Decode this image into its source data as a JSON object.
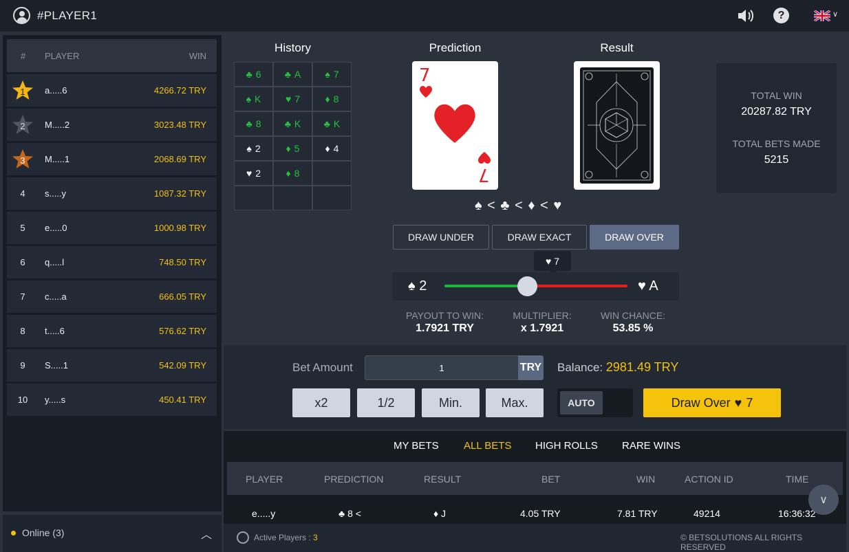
{
  "header": {
    "player_name": "#PLAYER1"
  },
  "leaderboard": {
    "columns": {
      "rank": "#",
      "player": "PLAYER",
      "win": "WIN"
    },
    "rows": [
      {
        "rank": "1",
        "player": "a.....6",
        "win": "4266.72 TRY",
        "medal": "gold"
      },
      {
        "rank": "2",
        "player": "M.....2",
        "win": "3023.48 TRY",
        "medal": "silver"
      },
      {
        "rank": "3",
        "player": "M.....1",
        "win": "2068.69 TRY",
        "medal": "bronze"
      },
      {
        "rank": "4",
        "player": "s.....y",
        "win": "1087.32 TRY"
      },
      {
        "rank": "5",
        "player": "e.....0",
        "win": "1000.98 TRY"
      },
      {
        "rank": "6",
        "player": "q.....l",
        "win": "748.50 TRY"
      },
      {
        "rank": "7",
        "player": "c.....a",
        "win": "666.05 TRY"
      },
      {
        "rank": "8",
        "player": "t.....6",
        "win": "576.62 TRY"
      },
      {
        "rank": "9",
        "player": "S.....1",
        "win": "542.09 TRY"
      },
      {
        "rank": "10",
        "player": "y.....s",
        "win": "450.41 TRY"
      }
    ],
    "online_label": "Online (3)"
  },
  "history": {
    "title": "History",
    "cells": [
      {
        "suit": "♣",
        "rank": "6",
        "color": "green"
      },
      {
        "suit": "♣",
        "rank": "A",
        "color": "green"
      },
      {
        "suit": "♠",
        "rank": "7",
        "color": "green"
      },
      {
        "suit": "♠",
        "rank": "K",
        "color": "green"
      },
      {
        "suit": "♥",
        "rank": "7",
        "color": "green"
      },
      {
        "suit": "♦",
        "rank": "8",
        "color": "green"
      },
      {
        "suit": "♣",
        "rank": "8",
        "color": "green"
      },
      {
        "suit": "♣",
        "rank": "K",
        "color": "green"
      },
      {
        "suit": "♣",
        "rank": "K",
        "color": "green"
      },
      {
        "suit": "♠",
        "rank": "2",
        "color": "white"
      },
      {
        "suit": "♦",
        "rank": "5",
        "color": "green"
      },
      {
        "suit": "♦",
        "rank": "4",
        "color": "white"
      },
      {
        "suit": "♥",
        "rank": "2",
        "color": "white"
      },
      {
        "suit": "♦",
        "rank": "8",
        "color": "green"
      },
      {
        "suit": "",
        "rank": "",
        "color": "white"
      },
      {
        "suit": "",
        "rank": "",
        "color": "white"
      },
      {
        "suit": "",
        "rank": "",
        "color": "white"
      },
      {
        "suit": "",
        "rank": "",
        "color": "white"
      }
    ]
  },
  "prediction": {
    "title": "Prediction",
    "rank": "7",
    "suit": "♥"
  },
  "result": {
    "title": "Result"
  },
  "suit_order": "♠ < ♣ < ♦ < ♥",
  "totals": {
    "total_win_label": "TOTAL WIN",
    "total_win_value": "20287.82 TRY",
    "total_bets_label": "TOTAL BETS MADE",
    "total_bets_value": "5215"
  },
  "draw_buttons": {
    "under": "DRAW UNDER",
    "exact": "DRAW EXACT",
    "over": "DRAW OVER"
  },
  "slider": {
    "tooltip_suit": "♥",
    "tooltip_rank": "7",
    "min_suit": "♠",
    "min_rank": "2",
    "max_suit": "♥",
    "max_rank": "A",
    "value_fraction": 0.45
  },
  "stats": {
    "payout_label": "PAYOUT TO WIN:",
    "payout_value": "1.7921 TRY",
    "multiplier_label": "MULTIPLIER:",
    "multiplier_value": "x 1.7921",
    "chance_label": "WIN CHANCE:",
    "chance_value": "53.85 %"
  },
  "bet": {
    "label": "Bet Amount",
    "amount": "1",
    "currency": "TRY",
    "balance_label": "Balance:",
    "balance_value": "2981.49 TRY",
    "double": "x2",
    "half": "1/2",
    "min": "Min.",
    "max": "Max.",
    "auto": "AUTO",
    "draw_label": "Draw Over",
    "draw_suit": "♥",
    "draw_rank": "7"
  },
  "bets_tabs": {
    "my": "MY BETS",
    "all": "ALL BETS",
    "high": "HIGH ROLLS",
    "rare": "RARE WINS"
  },
  "bets_table": {
    "headers": {
      "player": "PLAYER",
      "prediction": "PREDICTION",
      "result": "RESULT",
      "bet": "BET",
      "win": "WIN",
      "action": "ACTION ID",
      "time": "TIME"
    },
    "row": {
      "player": "e.....y",
      "prediction": "♣ 8 <",
      "result": "♦ J",
      "bet": "4.05 TRY",
      "win": "7.81 TRY",
      "action": "49214",
      "time": "16:36:32"
    }
  },
  "footer": {
    "active_label": "Active Players :",
    "active_count": "3",
    "copyright": "© BETSOLUTIONS ALL RIGHTS RESERVED"
  },
  "colors": {
    "accent": "#f2c011",
    "win_green": "#21b43a",
    "lose_red": "#e3221f"
  }
}
